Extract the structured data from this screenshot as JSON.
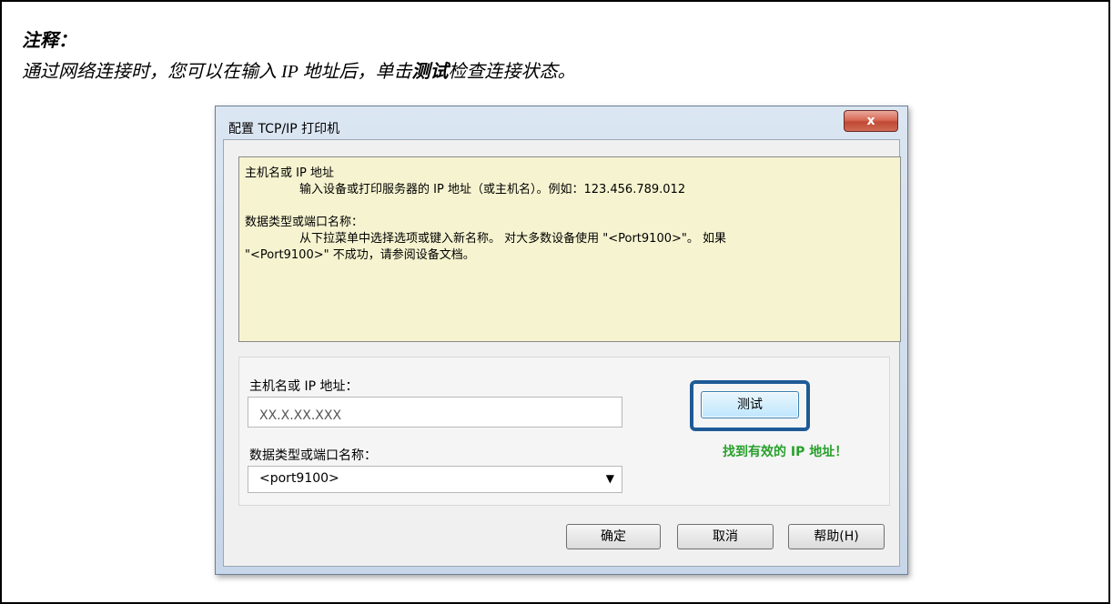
{
  "note": {
    "title": "注释：",
    "text_before": "通过网络连接时，您可以在输入 IP 地址后，单击",
    "text_bold": "测试",
    "text_after": "检查连接状态。"
  },
  "dialog": {
    "title": "配置 TCP/IP 打印机",
    "close_label": "x",
    "help": {
      "host_heading": "主机名或 IP 地址",
      "host_desc": "输入设备或打印服务器的 IP 地址（或主机名）。例如：123.456.789.012",
      "port_heading": "数据类型或端口名称：",
      "port_desc_line1": "从下拉菜单中选择选项或键入新名称。 对大多数设备使用 \"<Port9100>\"。 如果",
      "port_desc_line2": "\"<Port9100>\" 不成功，请参阅设备文档。"
    },
    "host_label": "主机名或 IP 地址：",
    "host_value": "XX.X.XX.XXX",
    "port_label": "数据类型或端口名称：",
    "port_value": "<port9100>",
    "test_button": "测试",
    "status_text": "找到有效的 IP 地址！",
    "ok_button": "确定",
    "cancel_button": "取消",
    "help_button": "帮助(H)"
  }
}
